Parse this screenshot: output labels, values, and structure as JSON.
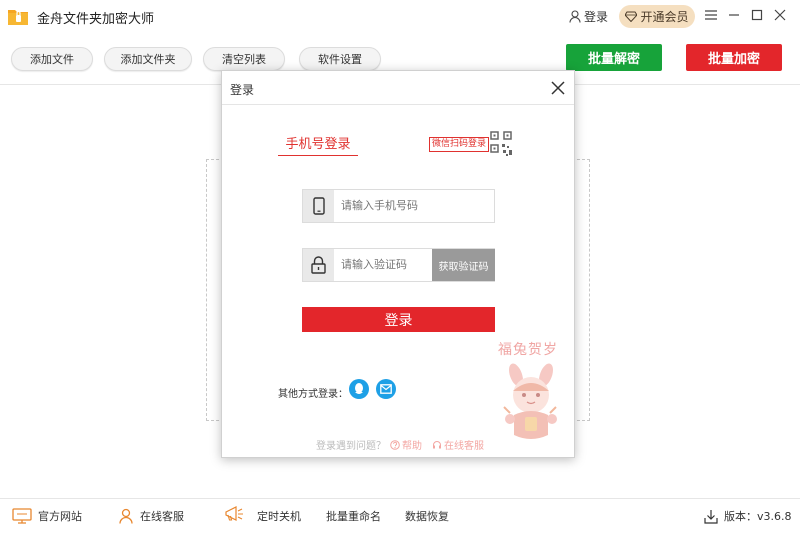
{
  "app": {
    "title": "金舟文件夹加密大师",
    "login_label": "登录",
    "vip_label": "开通会员"
  },
  "toolbar": {
    "add_file": "添加文件",
    "add_folder": "添加文件夹",
    "clear_list": "清空列表",
    "settings": "软件设置",
    "batch_decrypt": "批量解密",
    "batch_encrypt": "批量加密"
  },
  "dialog": {
    "title": "登录",
    "tab_phone": "手机号登录",
    "qr_login": "微信扫码登录",
    "phone_placeholder": "请输入手机号码",
    "code_placeholder": "请输入验证码",
    "get_code": "获取验证码",
    "submit": "登录",
    "other_login": "其他方式登录：",
    "help_question": "登录遇到问题？",
    "help": "帮助",
    "service": "在线客服",
    "mascot_text": "福兔贺岁"
  },
  "statusbar": {
    "website": "官方网站",
    "service": "在线客服",
    "shutdown": "定时关机",
    "rename": "批量重命名",
    "recovery": "数据恢复",
    "version": "版本：v3.6.8"
  },
  "colors": {
    "red": "#e3262b",
    "green": "#17a33a",
    "vip_bg": "#f5dfc0",
    "social_blue": "#1ea0e6"
  }
}
